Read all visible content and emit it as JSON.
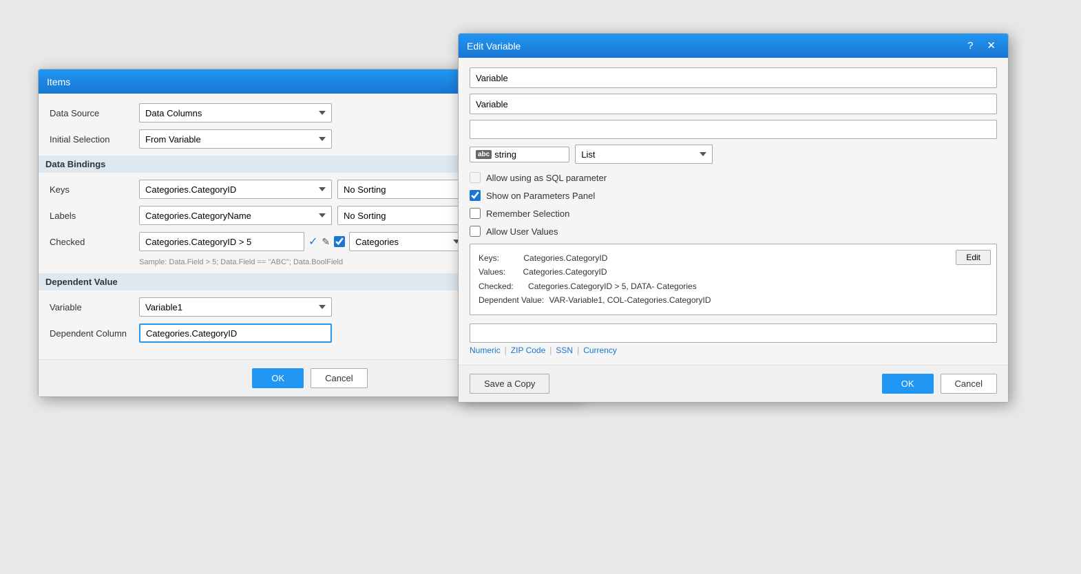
{
  "items_dialog": {
    "title": "Items",
    "data_source_label": "Data Source",
    "data_source_value": "Data Columns",
    "initial_selection_label": "Initial Selection",
    "initial_selection_value": "From Variable",
    "data_bindings_header": "Data Bindings",
    "keys_label": "Keys",
    "keys_column_value": "Categories.CategoryID",
    "keys_sorting_value": "No Sorting",
    "labels_label": "Labels",
    "labels_column_value": "Categories.CategoryName",
    "labels_sorting_value": "No Sorting",
    "checked_label": "Checked",
    "checked_expr_value": "Categories.CategoryID > 5",
    "checked_data_value": "Categories",
    "sample_text": "Sample:   Data.Field > 5; Data.Field == \"ABC\"; Data.BoolField",
    "dependent_value_header": "Dependent Value",
    "variable_label": "Variable",
    "variable_value": "Variable1",
    "dependent_column_label": "Dependent Column",
    "dependent_column_value": "Categories.CategoryID",
    "ok_label": "OK",
    "cancel_label": "Cancel"
  },
  "edit_variable_dialog": {
    "title": "Edit Variable",
    "var_name_placeholder": "Variable",
    "var_name_value": "Variable",
    "var_desc_placeholder": "Variable",
    "var_desc_value": "Variable",
    "var_empty_placeholder": "",
    "type_badge": "abc",
    "type_value": "string",
    "list_value": "List",
    "allow_sql_label": "Allow using as SQL parameter",
    "show_params_label": "Show on Parameters Panel",
    "remember_selection_label": "Remember Selection",
    "allow_user_values_label": "Allow User Values",
    "info_keys": "Keys:",
    "info_keys_value": "Categories.CategoryID",
    "info_values": "Values:",
    "info_values_value": "Categories.CategoryID",
    "info_checked": "Checked:",
    "info_checked_value": "Categories.CategoryID > 5, DATA- Categories",
    "info_dependent": "Dependent Value:",
    "info_dependent_value": "VAR-Variable1, COL-Categories.CategoryID",
    "edit_btn_label": "Edit",
    "mask_placeholder": "",
    "numeric_label": "Numeric",
    "zipcode_label": "ZIP Code",
    "ssn_label": "SSN",
    "currency_label": "Currency",
    "ok_label": "OK",
    "cancel_label": "Cancel",
    "save_copy_label": "Save a Copy"
  },
  "icons": {
    "question_mark": "?",
    "close": "✕",
    "check": "✓",
    "pencil": "✎",
    "chevron_down": "▾",
    "checkbox_checked": "☑",
    "checkbox_unchecked": "☐"
  }
}
